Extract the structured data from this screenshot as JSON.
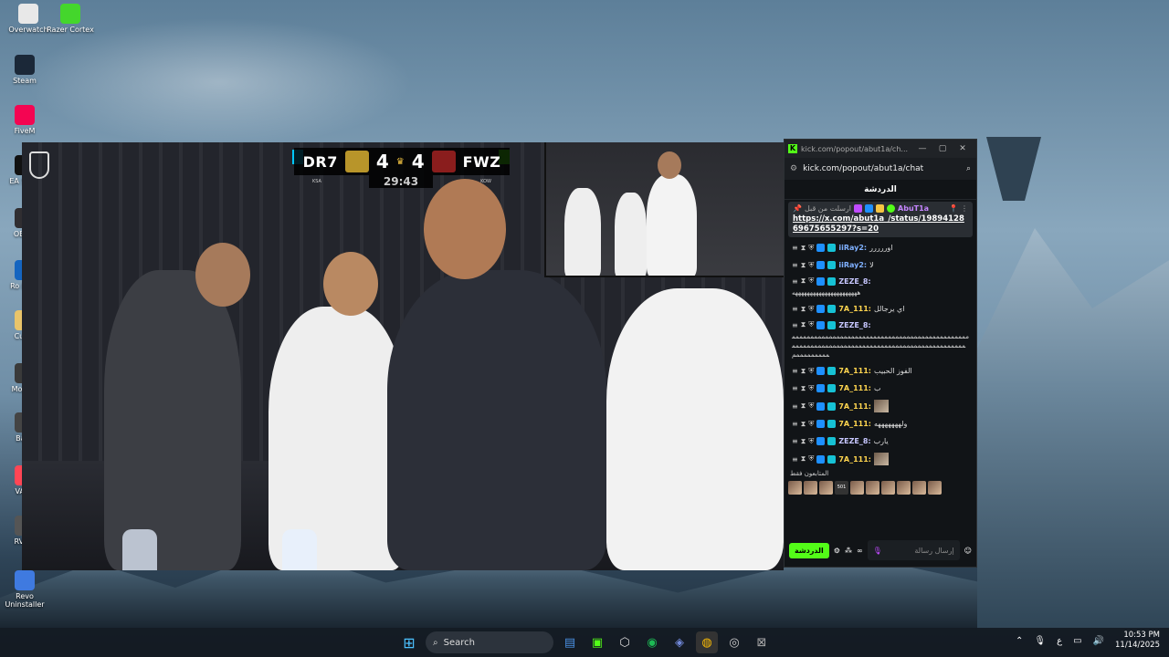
{
  "desktop": {
    "icons": [
      {
        "label": "Overwatch",
        "icon": "overwatch-icon",
        "color": "#e8e8e8"
      },
      {
        "label": "Razer Cortex",
        "icon": "razer-cortex-icon",
        "color": "#44d62c"
      },
      {
        "label": "Steam",
        "icon": "steam-icon",
        "color": "#1b2838"
      },
      {
        "label": "FiveM",
        "icon": "fivem-icon",
        "color": "#f40552"
      },
      {
        "label": "EA SI FC",
        "icon": "ea-icon",
        "color": "#111111"
      },
      {
        "label": "OBS S",
        "icon": "obs-icon",
        "color": "#302e31"
      },
      {
        "label": "Ro Leag",
        "icon": "rocket-league-icon",
        "color": "#1565c0"
      },
      {
        "label": "Custo",
        "icon": "folder-icon",
        "color": "#e9c46a"
      },
      {
        "label": "Mon Dr",
        "icon": "monster-icon",
        "color": "#3a3a3a"
      },
      {
        "label": "Bakk",
        "icon": "app-icon",
        "color": "#444444"
      },
      {
        "label": "VALO",
        "icon": "valorant-icon",
        "color": "#ff4655"
      },
      {
        "label": "RV Th",
        "icon": "game-icon",
        "color": "#555555"
      },
      {
        "label": "Revo Uninstaller",
        "icon": "revo-uninstaller-icon",
        "color": "#3f7ae0"
      }
    ]
  },
  "video": {
    "team_left": "DR7",
    "team_right": "FWZ",
    "score_left": "4",
    "score_right": "4",
    "clock": "29:43",
    "country_left": "KSA",
    "country_right": "KOW",
    "accent_left": "#00c8ff",
    "accent_right": "#53fc18"
  },
  "chat_window": {
    "title": "kick.com/popout/abut1a/ch...",
    "url": "kick.com/popout/abut1a/chat",
    "header": "الدردشة",
    "pinned": {
      "label": "ارسلت من قبل",
      "user": "AbuT1a",
      "link": "https://x.com/abut1a_/status/1989412869675655297?s=20"
    },
    "messages": [
      {
        "user": "iiRay2:",
        "text": "اوررررر",
        "color": "#7fb0ff"
      },
      {
        "user": "iiRay2:",
        "text": "لا",
        "color": "#7fb0ff"
      },
      {
        "user": "ZEZE_8:",
        "text": "",
        "long": "ههههههههههههههههههههههه",
        "color": "#c7c7ff"
      },
      {
        "user": "7A_111:",
        "text": "اي يرجالل",
        "color": "#ffd54f"
      },
      {
        "user": "ZEZE_8:",
        "text": "",
        "long": "ممممممممممممممممممممممممممممممممممممممممممممممممممممممممممممممممممممممممممممممممممممممممممممممممممممممممم",
        "color": "#c7c7ff"
      },
      {
        "user": "7A_111:",
        "text": "الفوز الحبيب",
        "color": "#ffd54f"
      },
      {
        "user": "7A_111:",
        "text": "ب",
        "color": "#ffd54f"
      },
      {
        "user": "7A_111:",
        "text": "",
        "image": true,
        "color": "#ffd54f"
      },
      {
        "user": "7A_111:",
        "text": "ولهههههههه",
        "color": "#ffd54f"
      },
      {
        "user": "ZEZE_8:",
        "text": "يارب",
        "color": "#c7c7ff"
      },
      {
        "user": "7A_111:",
        "text": "",
        "image": true,
        "color": "#ffd54f"
      }
    ],
    "viewers_label": "المتابعون فقط",
    "avatar_count": "501",
    "send_label": "الدردشة",
    "input_placeholder": "إرسال رسالة"
  },
  "taskbar": {
    "search_label": "Search",
    "language": "ع",
    "time": "10:53 PM",
    "date": "11/14/2025",
    "apps": [
      "windows-start-icon",
      "search-icon",
      "file-explorer-icon",
      "minecraft-icon",
      "epic-games-icon",
      "spotify-icon",
      "discord-icon",
      "chrome-icon",
      "steam-taskbar-icon",
      "terminal-icon"
    ]
  }
}
